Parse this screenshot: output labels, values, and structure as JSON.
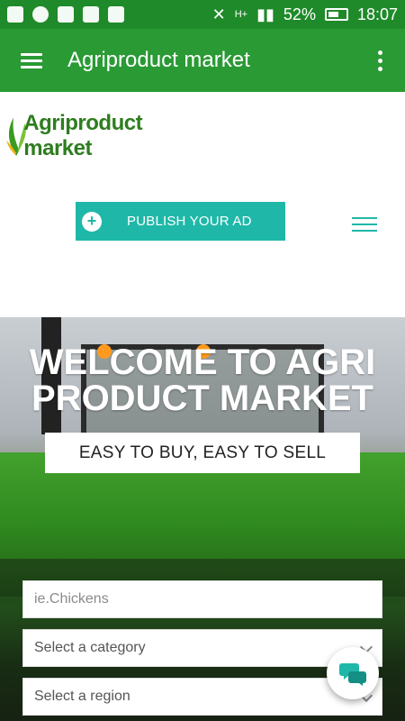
{
  "status_bar": {
    "battery_percent": "52%",
    "time": "18:07",
    "network_label": "H+"
  },
  "app_bar": {
    "title": "Agriproduct market",
    "menu_icon": "hamburger-menu-icon",
    "overflow_icon": "more-vertical-icon"
  },
  "logo": {
    "text": "Agriproduct market"
  },
  "publish_button": {
    "label": "PUBLISH YOUR AD",
    "icon": "plus-icon"
  },
  "hero": {
    "title": "WELCOME TO AGRI PRODUCT MARKET",
    "tagline": "EASY TO BUY, EASY TO SELL"
  },
  "search": {
    "query_placeholder": "ie.Chickens",
    "category_placeholder": "Select a category",
    "region_placeholder": "Select a region"
  },
  "colors": {
    "status_bar": "#1f8a2a",
    "app_bar": "#2a9a35",
    "accent_teal": "#1fb8a8",
    "logo_green": "#2e7d1f"
  }
}
